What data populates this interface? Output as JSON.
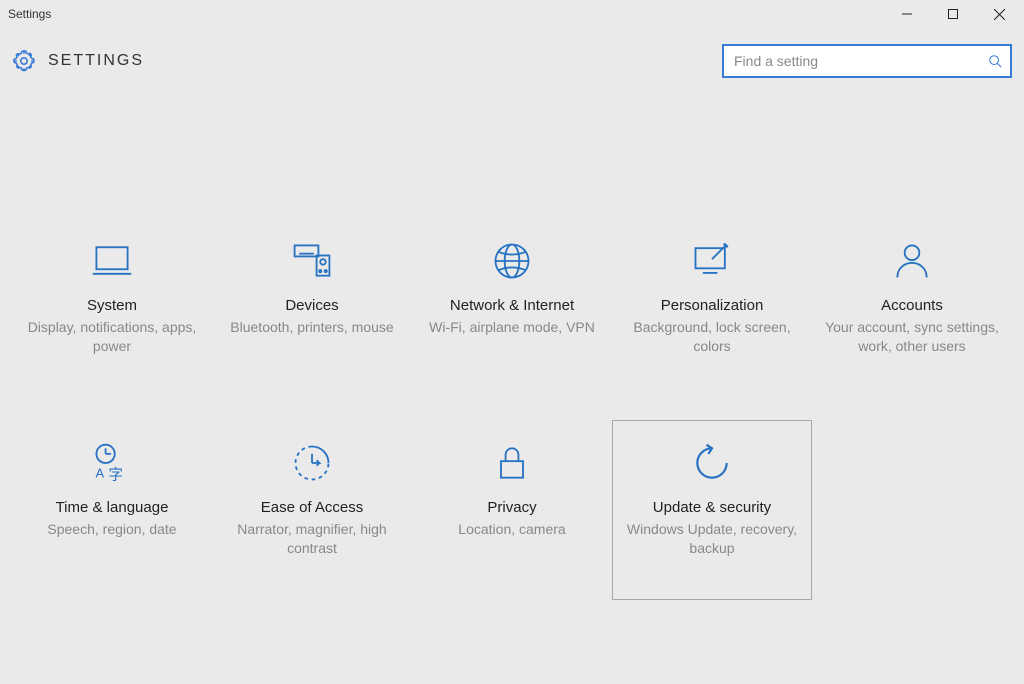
{
  "window": {
    "title": "Settings"
  },
  "header": {
    "page_title": "SETTINGS"
  },
  "search": {
    "placeholder": "Find a setting",
    "value": ""
  },
  "tiles": [
    {
      "title": "System",
      "subtitle": "Display, notifications, apps, power"
    },
    {
      "title": "Devices",
      "subtitle": "Bluetooth, printers, mouse"
    },
    {
      "title": "Network & Internet",
      "subtitle": "Wi-Fi, airplane mode, VPN"
    },
    {
      "title": "Personalization",
      "subtitle": "Background, lock screen, colors"
    },
    {
      "title": "Accounts",
      "subtitle": "Your account, sync settings, work, other users"
    },
    {
      "title": "Time & language",
      "subtitle": "Speech, region, date"
    },
    {
      "title": "Ease of Access",
      "subtitle": "Narrator, magnifier, high contrast"
    },
    {
      "title": "Privacy",
      "subtitle": "Location, camera"
    },
    {
      "title": "Update & security",
      "subtitle": "Windows Update, recovery, backup"
    }
  ],
  "hovered_tile_index": 8
}
